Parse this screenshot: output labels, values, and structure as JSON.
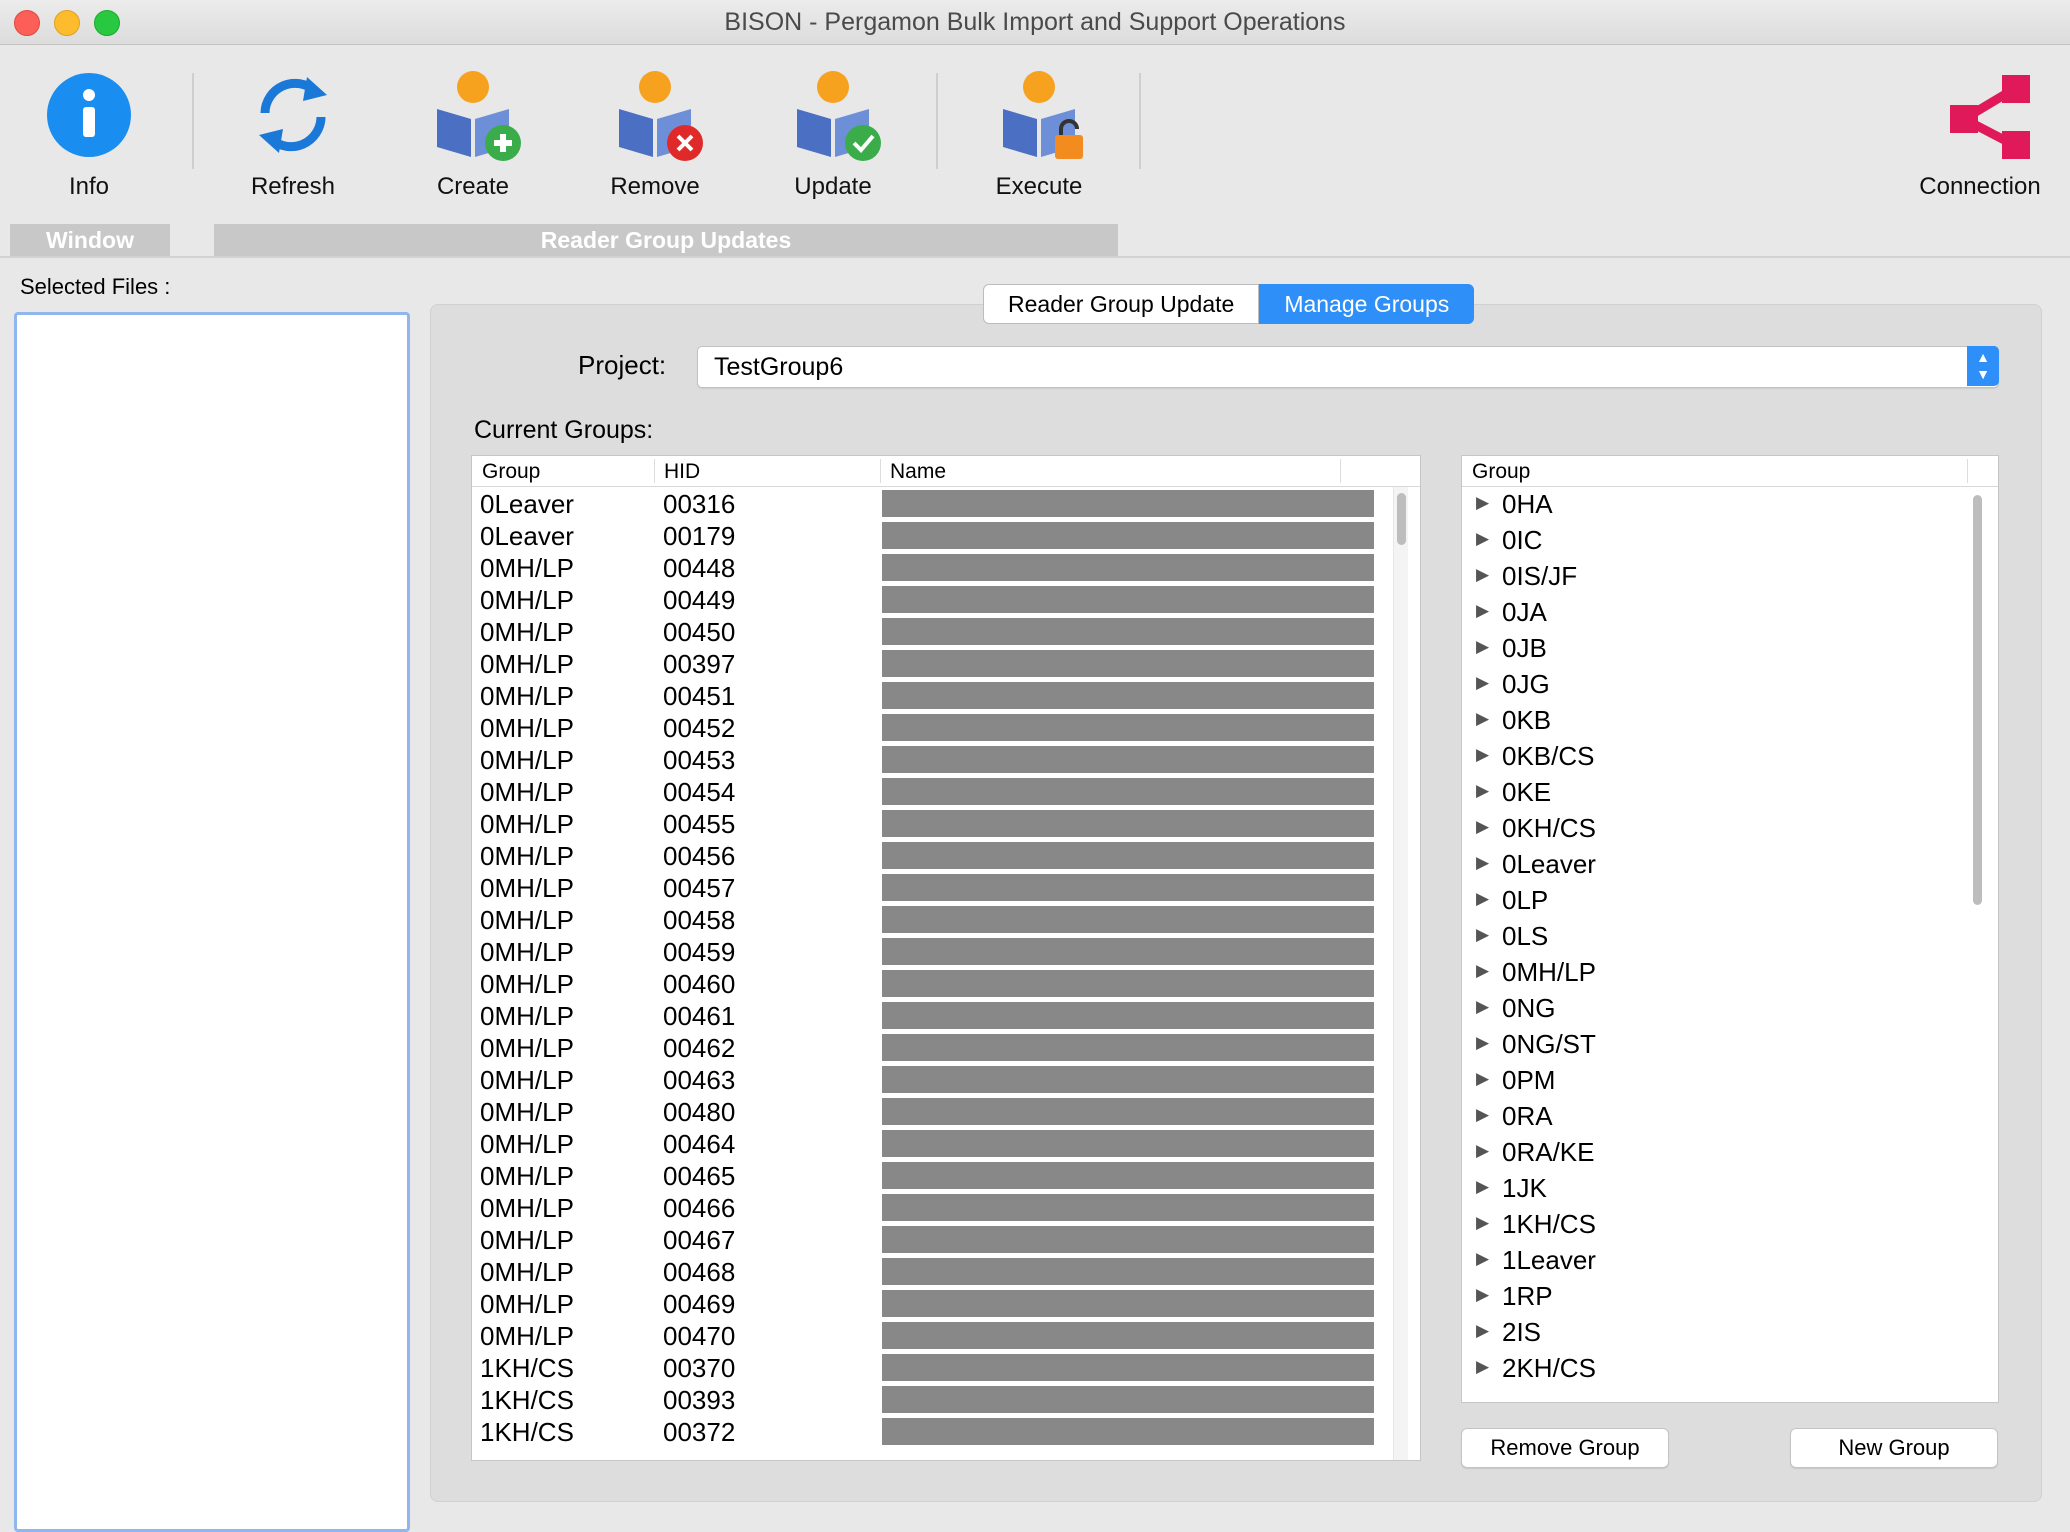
{
  "window": {
    "title": "BISON - Pergamon Bulk Import and Support Operations"
  },
  "toolbar": {
    "info": "Info",
    "refresh": "Refresh",
    "create": "Create",
    "remove": "Remove",
    "update": "Update",
    "execute": "Execute",
    "connection": "Connection",
    "group_window": "Window",
    "group_reader": "Reader Group Updates"
  },
  "sidebar": {
    "label": "Selected Files :"
  },
  "tabs": {
    "reader_group_update": "Reader Group Update",
    "manage_groups": "Manage Groups",
    "selected": "Manage Groups"
  },
  "project": {
    "label": "Project:",
    "value": "TestGroup6"
  },
  "current_groups": {
    "label": "Current Groups:",
    "columns": [
      "Group",
      "HID",
      "Name"
    ],
    "rows": [
      [
        "0Leaver",
        "00316"
      ],
      [
        "0Leaver",
        "00179"
      ],
      [
        "0MH/LP",
        "00448"
      ],
      [
        "0MH/LP",
        "00449"
      ],
      [
        "0MH/LP",
        "00450"
      ],
      [
        "0MH/LP",
        "00397"
      ],
      [
        "0MH/LP",
        "00451"
      ],
      [
        "0MH/LP",
        "00452"
      ],
      [
        "0MH/LP",
        "00453"
      ],
      [
        "0MH/LP",
        "00454"
      ],
      [
        "0MH/LP",
        "00455"
      ],
      [
        "0MH/LP",
        "00456"
      ],
      [
        "0MH/LP",
        "00457"
      ],
      [
        "0MH/LP",
        "00458"
      ],
      [
        "0MH/LP",
        "00459"
      ],
      [
        "0MH/LP",
        "00460"
      ],
      [
        "0MH/LP",
        "00461"
      ],
      [
        "0MH/LP",
        "00462"
      ],
      [
        "0MH/LP",
        "00463"
      ],
      [
        "0MH/LP",
        "00480"
      ],
      [
        "0MH/LP",
        "00464"
      ],
      [
        "0MH/LP",
        "00465"
      ],
      [
        "0MH/LP",
        "00466"
      ],
      [
        "0MH/LP",
        "00467"
      ],
      [
        "0MH/LP",
        "00468"
      ],
      [
        "0MH/LP",
        "00469"
      ],
      [
        "0MH/LP",
        "00470"
      ],
      [
        "1KH/CS",
        "00370"
      ],
      [
        "1KH/CS",
        "00393"
      ],
      [
        "1KH/CS",
        "00372"
      ]
    ]
  },
  "groups_tree": {
    "header": "Group",
    "items": [
      "0HA",
      "0IC",
      "0IS/JF",
      "0JA",
      "0JB",
      "0JG",
      "0KB",
      "0KB/CS",
      "0KE",
      "0KH/CS",
      "0Leaver",
      "0LP",
      "0LS",
      "0MH/LP",
      "0NG",
      "0NG/ST",
      "0PM",
      "0RA",
      "0RA/KE",
      "1JK",
      "1KH/CS",
      "1Leaver",
      "1RP",
      "2IS",
      "2KH/CS"
    ]
  },
  "buttons": {
    "remove_group": "Remove Group",
    "new_group": "New Group"
  },
  "colors": {
    "accent": "#2d8ff7",
    "info_blue": "#1a8ef0",
    "connection_pink": "#e0195a",
    "redaction": "#888888"
  }
}
